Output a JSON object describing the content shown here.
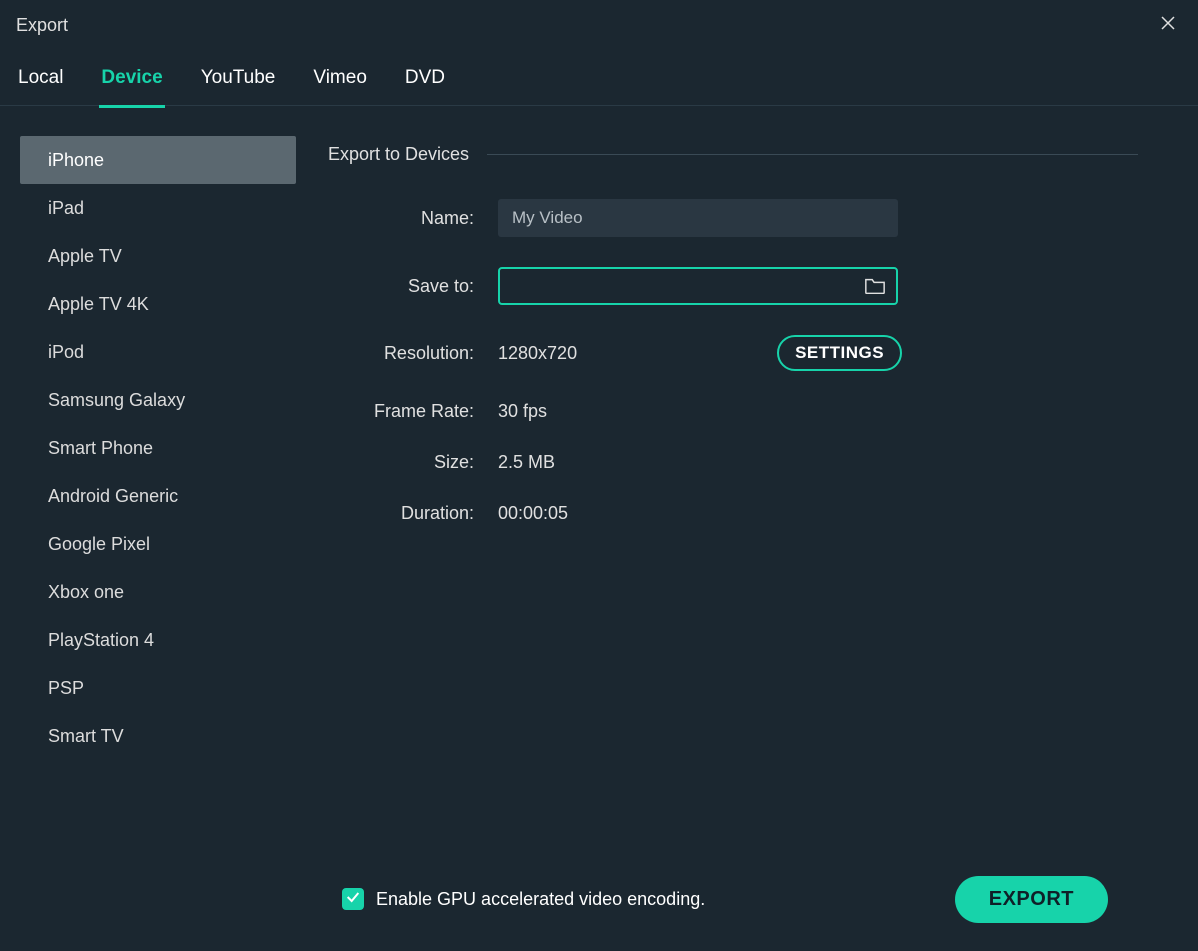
{
  "window": {
    "title": "Export"
  },
  "tabs": [
    {
      "label": "Local"
    },
    {
      "label": "Device",
      "active": true
    },
    {
      "label": "YouTube"
    },
    {
      "label": "Vimeo"
    },
    {
      "label": "DVD"
    }
  ],
  "devices": [
    {
      "label": "iPhone",
      "selected": true
    },
    {
      "label": "iPad"
    },
    {
      "label": "Apple TV"
    },
    {
      "label": "Apple TV 4K"
    },
    {
      "label": "iPod"
    },
    {
      "label": "Samsung Galaxy"
    },
    {
      "label": "Smart Phone"
    },
    {
      "label": "Android Generic"
    },
    {
      "label": "Google Pixel"
    },
    {
      "label": "Xbox one"
    },
    {
      "label": "PlayStation 4"
    },
    {
      "label": "PSP"
    },
    {
      "label": "Smart TV"
    }
  ],
  "section": {
    "title": "Export to Devices"
  },
  "form": {
    "name_label": "Name:",
    "name_value": "My Video",
    "saveto_label": "Save to:",
    "saveto_value": "",
    "resolution_label": "Resolution:",
    "resolution_value": "1280x720",
    "settings_label": "SETTINGS",
    "framerate_label": "Frame Rate:",
    "framerate_value": "30 fps",
    "size_label": "Size:",
    "size_value": "2.5 MB",
    "duration_label": "Duration:",
    "duration_value": "00:00:05"
  },
  "footer": {
    "gpu_checked": true,
    "gpu_label": "Enable GPU accelerated video encoding.",
    "export_label": "EXPORT"
  }
}
